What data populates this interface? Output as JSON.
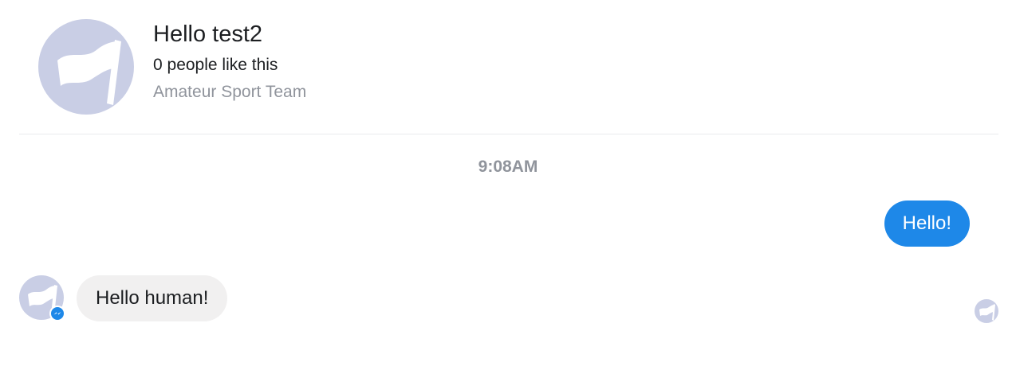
{
  "header": {
    "page_name": "Hello test2",
    "likes": "0 people like this",
    "category": "Amateur Sport Team",
    "avatar_icon": "flag-icon"
  },
  "conversation": {
    "timestamp": "9:08AM",
    "messages": [
      {
        "sender": "user",
        "text": "Hello!"
      },
      {
        "sender": "page",
        "text": "Hello human!"
      }
    ],
    "badge_icon": "messenger-icon",
    "seen_icon": "flag-icon"
  },
  "colors": {
    "outgoing_bubble": "#1e88e8",
    "incoming_bubble": "#f1f0f0",
    "avatar_bg": "#c9cee5",
    "secondary_text": "#90949c"
  }
}
